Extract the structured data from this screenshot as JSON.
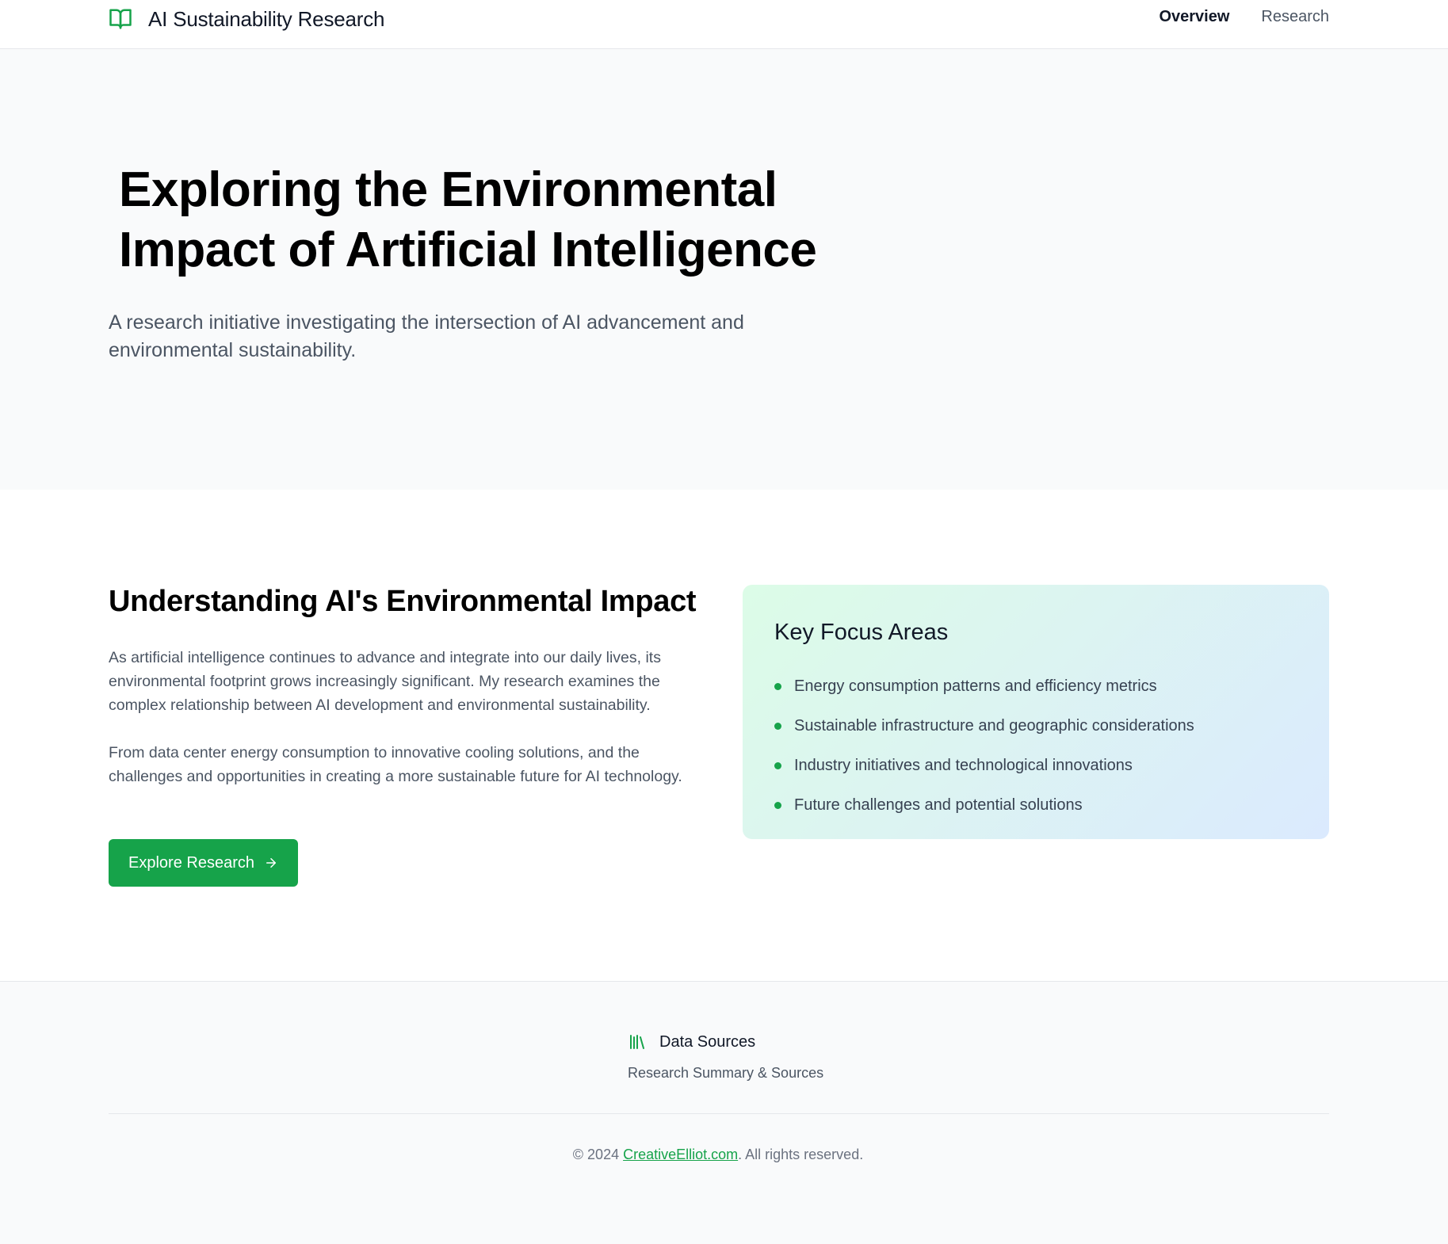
{
  "header": {
    "brand_icon": "open-book-icon",
    "title": "AI Sustainability Research",
    "nav": [
      {
        "label": "Overview",
        "active": true
      },
      {
        "label": "Research",
        "active": false
      }
    ]
  },
  "hero": {
    "title": "Exploring the Environmental Impact of Artificial Intelligence",
    "subtitle": "A research initiative investigating the intersection of AI advancement and environmental sustainability."
  },
  "main": {
    "title": "Understanding AI's Environmental Impact",
    "paragraphs": [
      "As artificial intelligence continues to advance and integrate into our daily lives, its environmental footprint grows increasingly significant. My research examines the complex relationship between AI development and environmental sustainability.",
      "From data center energy consumption to innovative cooling solutions, and the challenges and opportunities in creating a more sustainable future for AI technology."
    ],
    "cta": {
      "label": "Explore Research",
      "icon": "arrow-right-icon"
    }
  },
  "focus": {
    "title": "Key Focus Areas",
    "items": [
      "Energy consumption patterns and efficiency metrics",
      "Sustainable infrastructure and geographic considerations",
      "Industry initiatives and technological innovations",
      "Future challenges and potential solutions"
    ]
  },
  "footer": {
    "sources_icon": "library-icon",
    "sources_title": "Data Sources",
    "sources_subtitle": "Research Summary & Sources",
    "copyright_prefix": "© 2024 ",
    "copyright_link": "CreativeElliot.com",
    "copyright_suffix": ". All rights reserved."
  },
  "colors": {
    "accent": "#16a34a",
    "hero_bg": "#f9fafb",
    "text_muted": "#4b5563",
    "card_gradient_start": "#dcfce7",
    "card_gradient_end": "#dbeafe"
  }
}
